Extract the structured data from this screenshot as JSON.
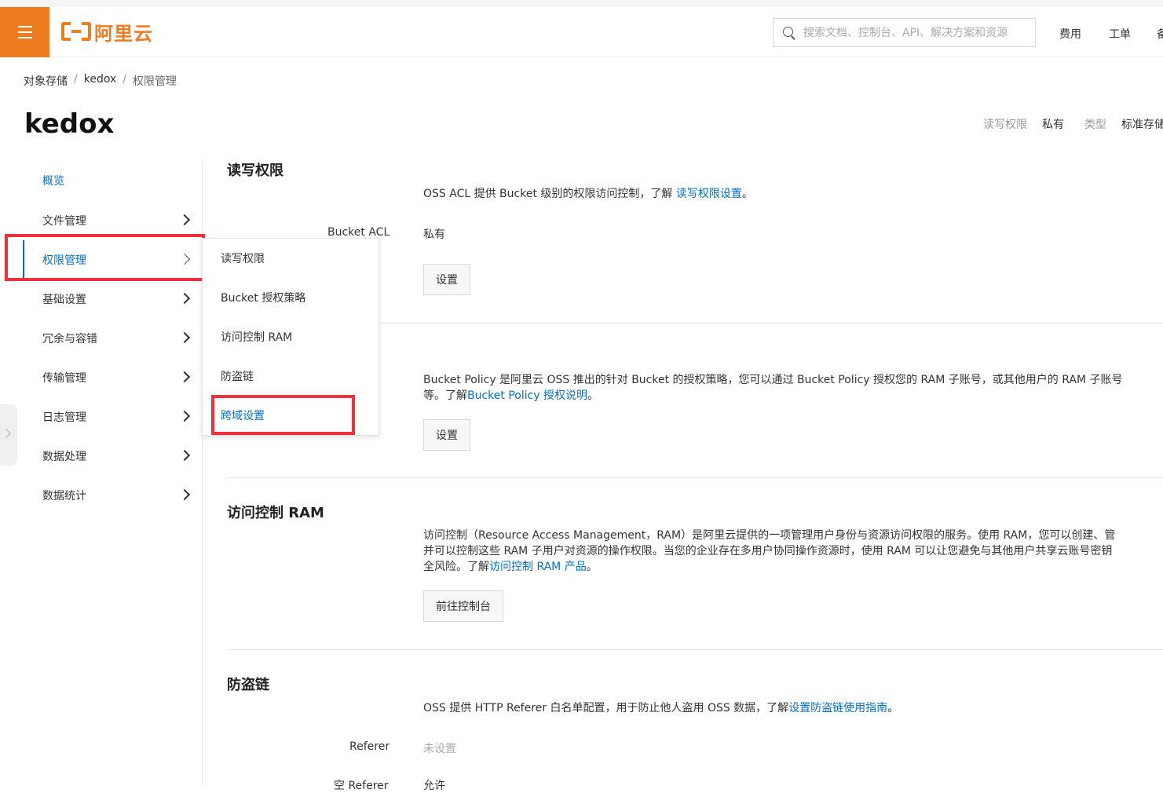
{
  "topbar": {
    "brand": "阿里云",
    "search_placeholder": "搜索文档、控制台、API、解决方案和资源",
    "links": [
      "费用",
      "工单",
      "备"
    ]
  },
  "breadcrumb": [
    "对象存储",
    "kedox",
    "权限管理"
  ],
  "page_title": "kedox",
  "meta": {
    "acl_label": "读写权限",
    "acl_value": "私有",
    "type_label": "类型",
    "type_value": "标准存储"
  },
  "sidebar": {
    "items": [
      {
        "label": "概览"
      },
      {
        "label": "文件管理"
      },
      {
        "label": "权限管理"
      },
      {
        "label": "基础设置"
      },
      {
        "label": "冗余与容错"
      },
      {
        "label": "传输管理"
      },
      {
        "label": "日志管理"
      },
      {
        "label": "数据处理"
      },
      {
        "label": "数据统计"
      }
    ]
  },
  "flyout": {
    "items": [
      {
        "label": "读写权限"
      },
      {
        "label": "Bucket 授权策略"
      },
      {
        "label": "访问控制 RAM"
      },
      {
        "label": "防盗链"
      },
      {
        "label": "跨域设置"
      }
    ]
  },
  "sections": {
    "acl": {
      "title": "读写权限",
      "desc_prefix": "OSS ACL 提供 Bucket 级别的权限访问控制，了解",
      "desc_link": "读写权限设置",
      "desc_suffix": "。",
      "field_label": "Bucket ACL",
      "field_value": "私有",
      "button": "设置"
    },
    "policy": {
      "desc_line1": "Bucket Policy 是阿里云 OSS 推出的针对 Bucket 的授权策略，您可以通过 Bucket Policy 授权您的 RAM 子账号，或其他用户的 RAM 子账号",
      "desc_line2_prefix": "等。了解",
      "desc_link": "Bucket Policy 授权说明",
      "desc_suffix": "。",
      "button": "设置"
    },
    "ram": {
      "title": "访问控制 RAM",
      "desc_line1": "访问控制（Resource Access Management，RAM）是阿里云提供的一项管理用户身份与资源访问权限的服务。使用 RAM，您可以创建、管",
      "desc_line2": "并可以控制这些 RAM 子用户对资源的操作权限。当您的企业存在多用户协同操作资源时，使用 RAM 可以让您避免与其他用户共享云账号密钥",
      "desc_line3_prefix": "全风险。了解",
      "desc_link": "访问控制 RAM 产品",
      "desc_suffix": "。",
      "button": "前往控制台"
    },
    "referer": {
      "title": "防盗链",
      "desc_prefix": "OSS 提供 HTTP Referer 白名单配置，用于防止他人盗用 OSS 数据，了解",
      "desc_link": "设置防盗链使用指南",
      "desc_suffix": "。",
      "field_label": "Referer",
      "field_value": "未设置",
      "field2_label": "空 Referer",
      "field2_value": "允许"
    }
  }
}
